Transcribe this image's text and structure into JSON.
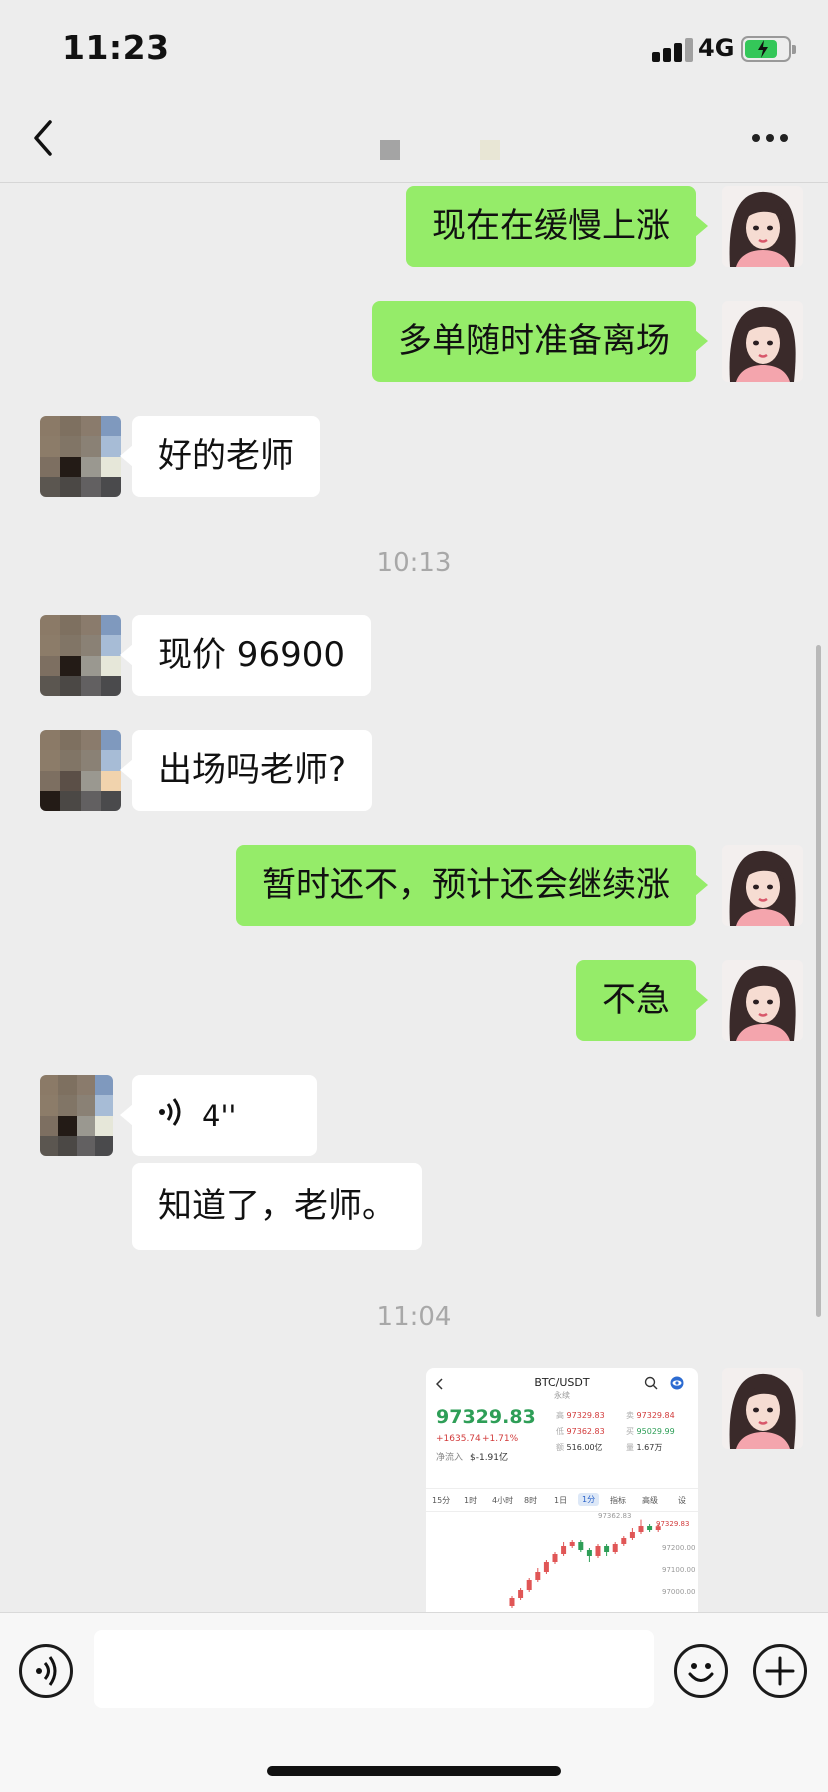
{
  "status_bar": {
    "time": "11:23",
    "network": "4G",
    "battery_level": 0.7
  },
  "nav": {
    "back_icon": "chevron-left-icon",
    "more_icon": "ellipsis-icon"
  },
  "messages": [
    {
      "side": "me",
      "text": "现在在缓慢上涨"
    },
    {
      "side": "me",
      "text": "多单随时准备离场"
    },
    {
      "side": "them",
      "text": "好的老师"
    },
    {
      "type": "timestamp",
      "text": "10:13"
    },
    {
      "side": "them",
      "text": "现价 96900"
    },
    {
      "side": "them",
      "text": "出场吗老师?"
    },
    {
      "side": "me",
      "text": "暂时还不，预计还会继续涨"
    },
    {
      "side": "me",
      "text": "不急"
    },
    {
      "side": "them",
      "type": "voice",
      "duration": "4''"
    },
    {
      "side": "them",
      "text": "知道了，老师。"
    },
    {
      "type": "timestamp",
      "text": "11:04"
    }
  ],
  "screenshot": {
    "pair": "BTC/USDT",
    "sub": "永续",
    "price": "97329.83",
    "change_abs": "+1635.74",
    "change_pct": "+1.71%",
    "inflow_label": "净流入",
    "inflow_value": "$-1.91亿",
    "stats": [
      {
        "label": "高",
        "value": "97329.83"
      },
      {
        "label": "卖",
        "value": "97329.84"
      },
      {
        "label": "低",
        "value": "97362.83"
      },
      {
        "label": "买",
        "value": "95029.99"
      },
      {
        "label": "额",
        "value": "516.00亿"
      },
      {
        "label": "量",
        "value": "1.67万"
      }
    ],
    "tabs": [
      "15分",
      "1时",
      "4小时",
      "8时",
      "1日",
      "1分",
      "指标",
      "高级",
      "设"
    ],
    "axis": [
      "97362.83",
      "97329.83",
      "97200.00",
      "97100.00",
      "97000.00"
    ],
    "candles": [
      {
        "o": 96930,
        "c": 96970,
        "h": 96980,
        "l": 96920
      },
      {
        "o": 96970,
        "c": 97010,
        "h": 97020,
        "l": 96960
      },
      {
        "o": 97010,
        "c": 97060,
        "h": 97070,
        "l": 97000
      },
      {
        "o": 97060,
        "c": 97100,
        "h": 97120,
        "l": 97050
      },
      {
        "o": 97100,
        "c": 97150,
        "h": 97160,
        "l": 97090
      },
      {
        "o": 97150,
        "c": 97190,
        "h": 97200,
        "l": 97140
      },
      {
        "o": 97190,
        "c": 97230,
        "h": 97250,
        "l": 97180
      },
      {
        "o": 97230,
        "c": 97250,
        "h": 97260,
        "l": 97220
      },
      {
        "o": 97250,
        "c": 97210,
        "h": 97260,
        "l": 97200
      },
      {
        "o": 97210,
        "c": 97180,
        "h": 97220,
        "l": 97150
      },
      {
        "o": 97180,
        "c": 97230,
        "h": 97240,
        "l": 97170
      },
      {
        "o": 97230,
        "c": 97200,
        "h": 97240,
        "l": 97180
      },
      {
        "o": 97200,
        "c": 97240,
        "h": 97250,
        "l": 97190
      },
      {
        "o": 97240,
        "c": 97270,
        "h": 97280,
        "l": 97230
      },
      {
        "o": 97270,
        "c": 97300,
        "h": 97320,
        "l": 97260
      },
      {
        "o": 97300,
        "c": 97330,
        "h": 97362,
        "l": 97290
      },
      {
        "o": 97330,
        "c": 97310,
        "h": 97340,
        "l": 97300
      },
      {
        "o": 97310,
        "c": 97329,
        "h": 97340,
        "l": 97300
      }
    ],
    "y_range": [
      96900,
      97380
    ]
  },
  "input_bar": {
    "voice_icon": "voice-icon",
    "emoji_icon": "emoji-icon",
    "plus_icon": "plus-icon"
  }
}
